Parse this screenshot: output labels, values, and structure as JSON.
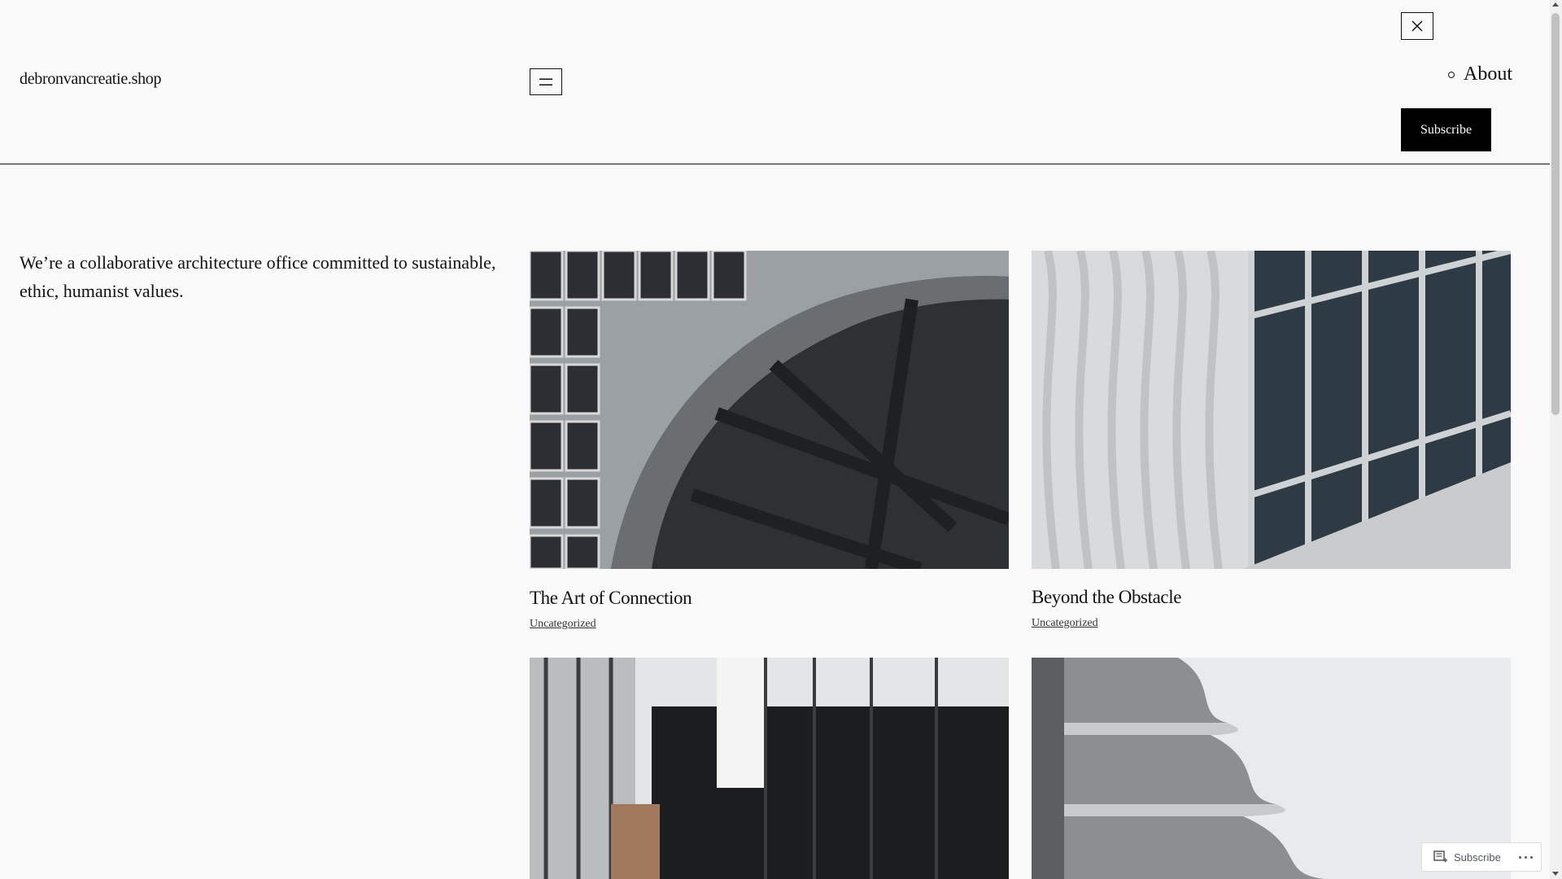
{
  "header": {
    "site_title": "debronvancreatie.shop",
    "nav_items": [
      {
        "label": "About"
      }
    ],
    "subscribe_label": "Subscribe"
  },
  "intro": {
    "text": "We’re a collaborative architecture office committed to sustainable, ethic, humanist values."
  },
  "posts": [
    {
      "title": "The Art of Connection",
      "category": "Uncategorized"
    },
    {
      "title": "Beyond the Obstacle",
      "category": "Uncategorized"
    },
    {
      "title": "",
      "category": ""
    },
    {
      "title": "",
      "category": ""
    }
  ],
  "wp_bar": {
    "subscribe_label": "Subscribe"
  },
  "icons": {
    "menu": "hamburger-icon",
    "close": "close-icon",
    "subscribe": "reader-icon",
    "more": "more-horizontal-icon"
  },
  "colors": {
    "background": "#f9f9f9",
    "text": "#111111",
    "button": "#000000"
  }
}
